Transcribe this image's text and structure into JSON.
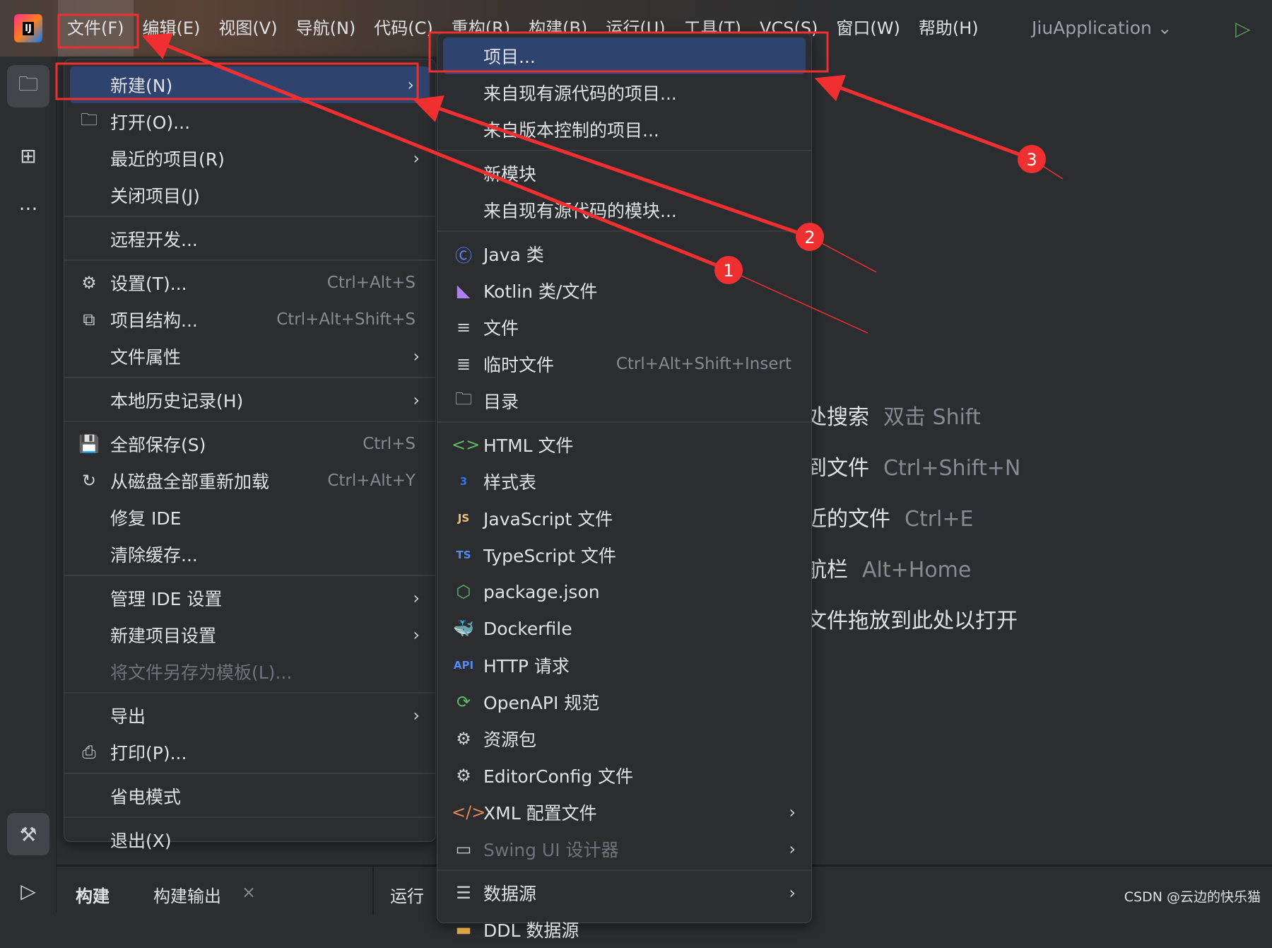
{
  "menubar": {
    "items": [
      "文件(F)",
      "编辑(E)",
      "视图(V)",
      "导航(N)",
      "代码(C)",
      "重构(R)",
      "构建(B)",
      "运行(U)",
      "工具(T)",
      "VCS(S)",
      "窗口(W)",
      "帮助(H)"
    ],
    "project": "JiuApplication ⌄"
  },
  "file_menu": [
    {
      "label": "新建(N)",
      "arrow": true,
      "selected": true
    },
    {
      "label": "打开(O)...",
      "icon": "folder-icon"
    },
    {
      "label": "最近的项目(R)",
      "arrow": true
    },
    {
      "label": "关闭项目(J)"
    },
    {
      "sep": true
    },
    {
      "label": "远程开发..."
    },
    {
      "sep": true
    },
    {
      "label": "设置(T)...",
      "icon": "gear-icon",
      "shortcut": "Ctrl+Alt+S"
    },
    {
      "label": "项目结构...",
      "icon": "project-structure-icon",
      "shortcut": "Ctrl+Alt+Shift+S"
    },
    {
      "label": "文件属性",
      "arrow": true
    },
    {
      "sep": true
    },
    {
      "label": "本地历史记录(H)",
      "arrow": true
    },
    {
      "sep": true
    },
    {
      "label": "全部保存(S)",
      "icon": "save-icon",
      "shortcut": "Ctrl+S"
    },
    {
      "label": "从磁盘全部重新加载",
      "icon": "reload-icon",
      "shortcut": "Ctrl+Alt+Y"
    },
    {
      "label": "修复 IDE"
    },
    {
      "label": "清除缓存..."
    },
    {
      "sep": true
    },
    {
      "label": "管理 IDE 设置",
      "arrow": true
    },
    {
      "label": "新建项目设置",
      "arrow": true
    },
    {
      "label": "将文件另存为模板(L)...",
      "disabled": true
    },
    {
      "sep": true
    },
    {
      "label": "导出",
      "arrow": true
    },
    {
      "label": "打印(P)...",
      "icon": "print-icon"
    },
    {
      "sep": true
    },
    {
      "label": "省电模式"
    },
    {
      "sep": true
    },
    {
      "label": "退出(X)"
    }
  ],
  "new_submenu": [
    {
      "label": "项目...",
      "selected": true
    },
    {
      "label": "来自现有源代码的项目..."
    },
    {
      "label": "来自版本控制的项目..."
    },
    {
      "sep": true
    },
    {
      "label": "新模块"
    },
    {
      "label": "来自现有源代码的模块..."
    },
    {
      "sep": true
    },
    {
      "label": "Java 类",
      "icon": "java-class-icon"
    },
    {
      "label": "Kotlin 类/文件",
      "icon": "kotlin-icon"
    },
    {
      "label": "文件",
      "icon": "file-icon"
    },
    {
      "label": "临时文件",
      "icon": "scratch-file-icon",
      "shortcut": "Ctrl+Alt+Shift+Insert"
    },
    {
      "label": "目录",
      "icon": "folder-icon"
    },
    {
      "sep": true
    },
    {
      "label": "HTML 文件",
      "icon": "html-icon"
    },
    {
      "label": "样式表",
      "icon": "css-icon"
    },
    {
      "label": "JavaScript 文件",
      "icon": "javascript-icon"
    },
    {
      "label": "TypeScript 文件",
      "icon": "typescript-icon"
    },
    {
      "label": "package.json",
      "icon": "nodejs-icon"
    },
    {
      "label": "Dockerfile",
      "icon": "docker-icon"
    },
    {
      "label": "HTTP 请求",
      "icon": "api-icon"
    },
    {
      "label": "OpenAPI 规范",
      "icon": "openapi-icon"
    },
    {
      "label": "资源包",
      "icon": "gear-icon"
    },
    {
      "label": "EditorConfig 文件",
      "icon": "gear-icon"
    },
    {
      "label": "XML 配置文件",
      "icon": "xml-icon",
      "arrow": true
    },
    {
      "label": "Swing UI 设计器",
      "icon": "swing-icon",
      "arrow": true,
      "disabled": true
    },
    {
      "sep": true
    },
    {
      "label": "数据源",
      "icon": "database-icon",
      "arrow": true
    },
    {
      "label": "DDL 数据源",
      "icon": "ddl-icon"
    }
  ],
  "welcome": [
    {
      "text": "处搜索",
      "key": "双击 Shift"
    },
    {
      "text": "到文件",
      "key": "Ctrl+Shift+N"
    },
    {
      "text": "近的文件",
      "key": "Ctrl+E"
    },
    {
      "text": "航栏",
      "key": "Alt+Home"
    },
    {
      "text": "文件拖放到此处以打开",
      "key": ""
    }
  ],
  "bottom_tabs": {
    "build": "构建",
    "build_output": "构建输出",
    "close": "×",
    "run": "运行"
  },
  "annotations": {
    "markers": [
      "1",
      "2",
      "3"
    ],
    "color": "#f03030"
  },
  "watermark": "CSDN @云边的快乐猫",
  "colors": {
    "selection": "#2e436e",
    "background": "#2b2d30"
  }
}
